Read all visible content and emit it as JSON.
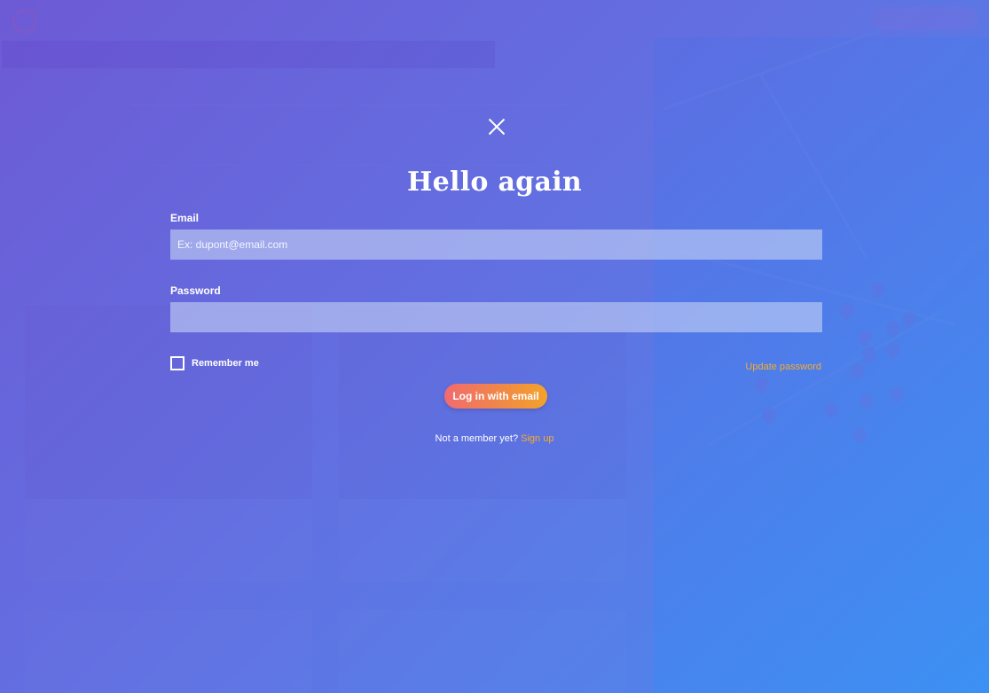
{
  "modal": {
    "title": "Hello again",
    "email_label": "Email",
    "email_placeholder": "Ex: dupont@email.com",
    "email_value": "",
    "password_label": "Password",
    "password_value": "",
    "remember_label": "Remember me",
    "remember_checked": false,
    "update_password": "Update password",
    "login_button": "Log in with email",
    "not_member_text": "Not a member yet?",
    "signup_link": "Sign up"
  },
  "colors": {
    "accent": "#f5ad2d",
    "button_gradient_start": "#f16b6f",
    "button_gradient_end": "#f3a22b",
    "overlay_start": "#6e50d2",
    "overlay_end": "#3c91f5"
  },
  "icons": {
    "close": "close-icon",
    "checkbox": "checkbox-icon"
  }
}
